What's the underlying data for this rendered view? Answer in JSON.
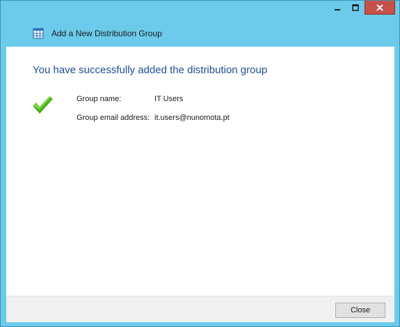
{
  "window": {
    "title": "Add a New Distribution Group",
    "controls": {
      "minimize_icon": "minimize-icon",
      "maximize_icon": "maximize-icon",
      "close_icon": "close-icon"
    }
  },
  "main": {
    "heading": "You have successfully added the distribution group",
    "status_icon": "checkmark-icon",
    "fields": [
      {
        "label": "Group name:",
        "value": "IT Users"
      },
      {
        "label": "Group email address:",
        "value": "it.users@nunomota.pt"
      }
    ]
  },
  "footer": {
    "close_label": "Close"
  },
  "colors": {
    "frame": "#6ccbeb",
    "heading": "#1f4e9a",
    "close_button_titlebar": "#c7504a",
    "checkmark": "#4caf1e"
  }
}
